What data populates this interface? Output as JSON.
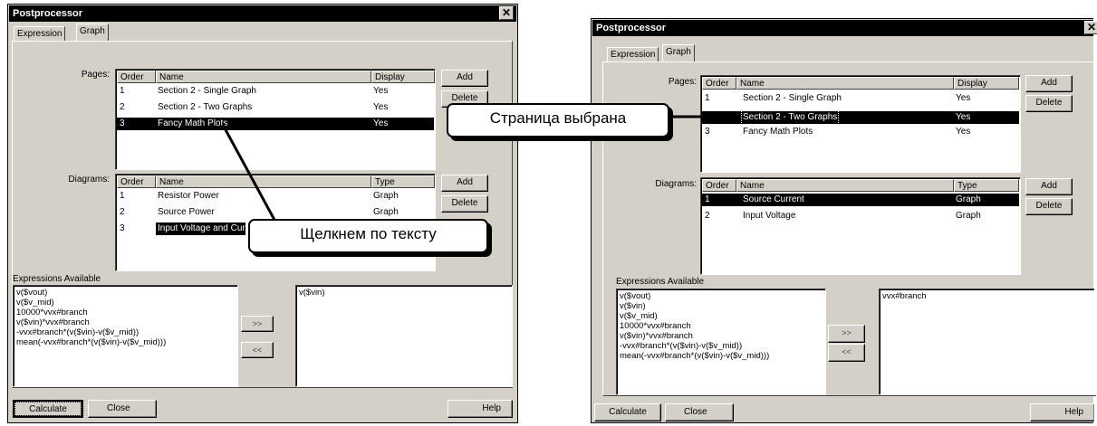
{
  "left_window": {
    "title": "Postprocessor",
    "close_glyph": "✕",
    "tabs": [
      "Expression",
      "Graph"
    ],
    "pages_label": "Pages:",
    "pages_headers": [
      "Order",
      "Name",
      "Display"
    ],
    "pages_rows": [
      {
        "order": "1",
        "name": "Section 2 - Single Graph",
        "display": "Yes"
      },
      {
        "order": "2",
        "name": "Section 2 - Two Graphs",
        "display": "Yes"
      },
      {
        "order": "3",
        "name": "Fancy Math Plots",
        "display": "Yes"
      }
    ],
    "diagrams_label": "Diagrams:",
    "diagrams_headers": [
      "Order",
      "Name",
      "Type"
    ],
    "diagrams_rows": [
      {
        "order": "1",
        "name": "Resistor Power",
        "type": "Graph"
      },
      {
        "order": "2",
        "name": "Source Power",
        "type": "Graph"
      },
      {
        "order": "3",
        "name": "Input Voltage and Cur",
        "type": ""
      }
    ],
    "add_label": "Add",
    "delete_label": "Delete",
    "expressions_label": "Expressions Available",
    "expressions": "v($vout)\nv($v_mid)\n10000*vvx#branch\nv($vin)*vvx#branch\n-vvx#branch*(v($vin)-v($v_mid))\nmean(-vvx#branch*(v($vin)-v($v_mid)))",
    "selected_expressions": "v($vin)",
    "add_expr_label": ">>",
    "remove_expr_label": "<<",
    "calculate_label": "Calculate",
    "close_label": "Close",
    "help_label": "Help"
  },
  "right_window": {
    "title": "Postprocessor",
    "close_glyph": "✕",
    "tabs": [
      "Expression",
      "Graph"
    ],
    "pages_label": "Pages:",
    "pages_headers": [
      "Order",
      "Name",
      "Display"
    ],
    "pages_rows": [
      {
        "order": "1",
        "name": "Section 2 - Single Graph",
        "display": "Yes"
      },
      {
        "order": "",
        "name": "Section 2 - Two Graphs",
        "display": "Yes"
      },
      {
        "order": "3",
        "name": "Fancy Math Plots",
        "display": "Yes"
      }
    ],
    "diagrams_label": "Diagrams:",
    "diagrams_headers": [
      "Order",
      "Name",
      "Type"
    ],
    "diagrams_rows": [
      {
        "order": "1",
        "name": "Source Current",
        "type": "Graph"
      },
      {
        "order": "2",
        "name": "Input Voltage",
        "type": "Graph"
      }
    ],
    "add_label": "Add",
    "delete_label": "Delete",
    "expressions_label": "Expressions Available",
    "expressions": "v($vout)\nv($vin)\nv($v_mid)\n10000*vvx#branch\nv($vin)*vvx#branch\n-vvx#branch*(v($vin)-v($v_mid))\nmean(-vvx#branch*(v($vin)-v($v_mid)))",
    "selected_expressions": "vvx#branch",
    "add_expr_label": ">>",
    "remove_expr_label": "<<",
    "calculate_label": "Calculate",
    "close_label": "Close",
    "help_label": "Help"
  },
  "callouts": {
    "page_selected": "Страница выбрана",
    "click_text": "Щелкнем по тексту"
  }
}
